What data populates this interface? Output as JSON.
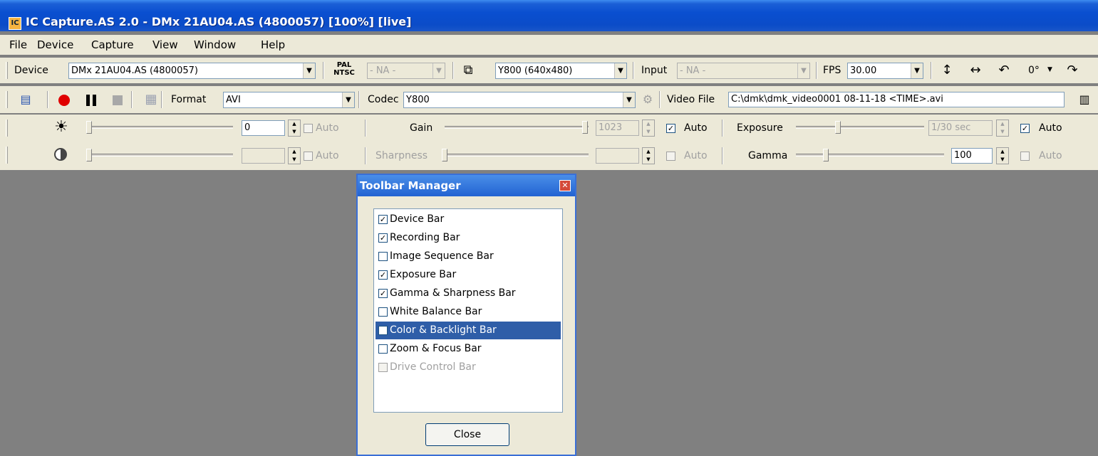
{
  "window": {
    "title": "IC Capture.AS 2.0 - DMx 21AU04.AS (4800057) [100%]  [live]",
    "app_icon": "IC"
  },
  "menu": [
    "File",
    "Device",
    "Capture",
    "View",
    "Window",
    "Help"
  ],
  "device_bar": {
    "device_label": "Device",
    "device_value": "DMx 21AU04.AS (4800057)",
    "pal_ntsc_top": "PAL",
    "pal_ntsc_bottom": "NTSC",
    "video_norm_value": "- NA -",
    "format_value": "Y800 (640x480)",
    "input_label": "Input",
    "input_value": "- NA -",
    "fps_label": "FPS",
    "fps_value": "30.00",
    "rotation_value": "0°"
  },
  "recording_bar": {
    "format_label": "Format",
    "format_value": "AVI",
    "codec_label": "Codec",
    "codec_value": "Y800",
    "video_file_label": "Video File",
    "video_file_value": "C:\\dmk\\dmk_video0001 08-11-18 <TIME>.avi"
  },
  "exposure_bar": {
    "brightness_value": "0",
    "brightness_auto": "Auto",
    "gain_label": "Gain",
    "gain_value": "1023",
    "gain_auto": "Auto",
    "exposure_label": "Exposure",
    "exposure_value": "1/30 sec",
    "exposure_auto": "Auto"
  },
  "gamma_bar": {
    "contrast_value": "",
    "contrast_auto": "Auto",
    "sharpness_label": "Sharpness",
    "sharpness_value": "",
    "sharpness_auto": "Auto",
    "gamma_label": "Gamma",
    "gamma_value": "100",
    "gamma_auto": "Auto"
  },
  "dialog": {
    "title": "Toolbar Manager",
    "close_button": "Close",
    "items": [
      {
        "label": "Device Bar",
        "checked": true
      },
      {
        "label": "Recording Bar",
        "checked": true
      },
      {
        "label": "Image Sequence Bar",
        "checked": false
      },
      {
        "label": "Exposure Bar",
        "checked": true
      },
      {
        "label": "Gamma & Sharpness Bar",
        "checked": true
      },
      {
        "label": "White Balance Bar",
        "checked": false
      },
      {
        "label": "Color & Backlight Bar",
        "checked": false,
        "selected": true
      },
      {
        "label": "Zoom & Focus Bar",
        "checked": false
      },
      {
        "label": "Drive Control Bar",
        "checked": false,
        "disabled": true
      }
    ]
  }
}
